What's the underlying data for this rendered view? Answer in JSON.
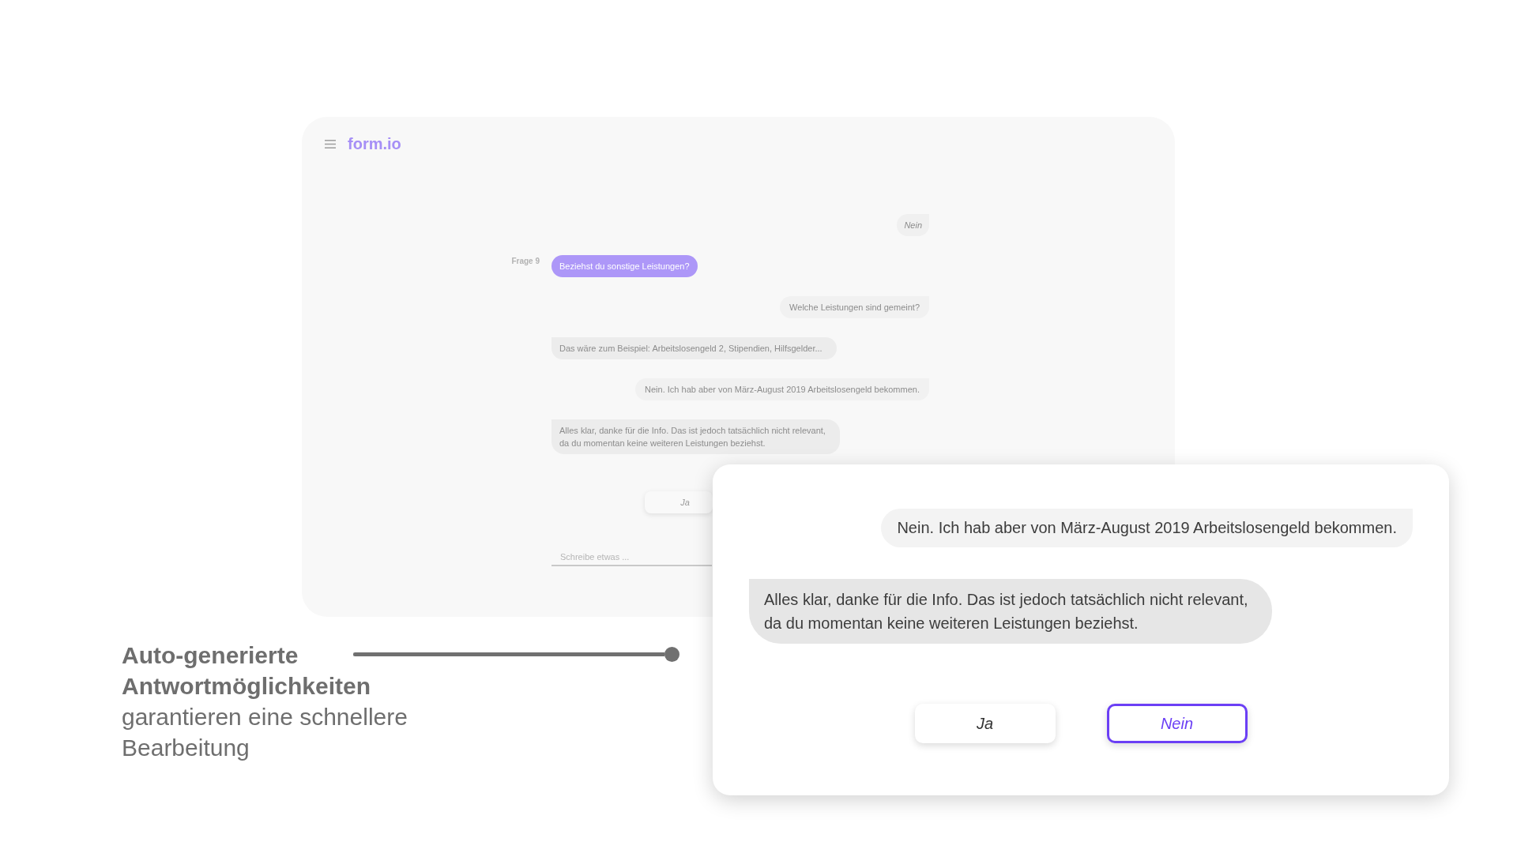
{
  "app_window": {
    "logo": "form.io",
    "messages": [
      {
        "kind": "answer",
        "text": "Nein"
      },
      {
        "kind": "question",
        "label": "Frage 9",
        "text": "Beziehst du sonstige Leistungen?"
      },
      {
        "kind": "user",
        "text": "Welche Leistungen sind gemeint?"
      },
      {
        "kind": "bot",
        "text": "Das wäre zum Beispiel: Arbeitslosengeld 2, Stipendien, Hilfsgelder..."
      },
      {
        "kind": "user",
        "text": "Nein. Ich hab aber von März-August 2019 Arbeitslosengeld bekommen."
      },
      {
        "kind": "bot",
        "text": "Alles klar, danke für die Info. Das ist jedoch tatsächlich nicht relevant,\nda du momentan keine weiteren Leistungen beziehst."
      }
    ],
    "reply_options": [
      {
        "label": "Ja",
        "selected": false
      }
    ],
    "input": {
      "placeholder": "Schreibe etwas ..."
    }
  },
  "caption": {
    "text": "**Auto-generierte Antwortmöglichkeiten** garantieren eine schnellere Bearbeitung"
  },
  "slider": {
    "level": 1
  },
  "zoom_panel": {
    "messages": [
      {
        "kind": "user",
        "text": "Nein. Ich hab aber von März-August 2019 Arbeitslosengeld bekommen."
      },
      {
        "kind": "bot",
        "text": "Alles klar, danke für die Info. Das ist jedoch tatsächlich nicht relevant,\nda du momentan keine weiteren Leistungen beziehst."
      }
    ],
    "reply_options": [
      {
        "label": "Ja",
        "selected": false
      },
      {
        "label": "Nein",
        "selected": true
      }
    ]
  }
}
